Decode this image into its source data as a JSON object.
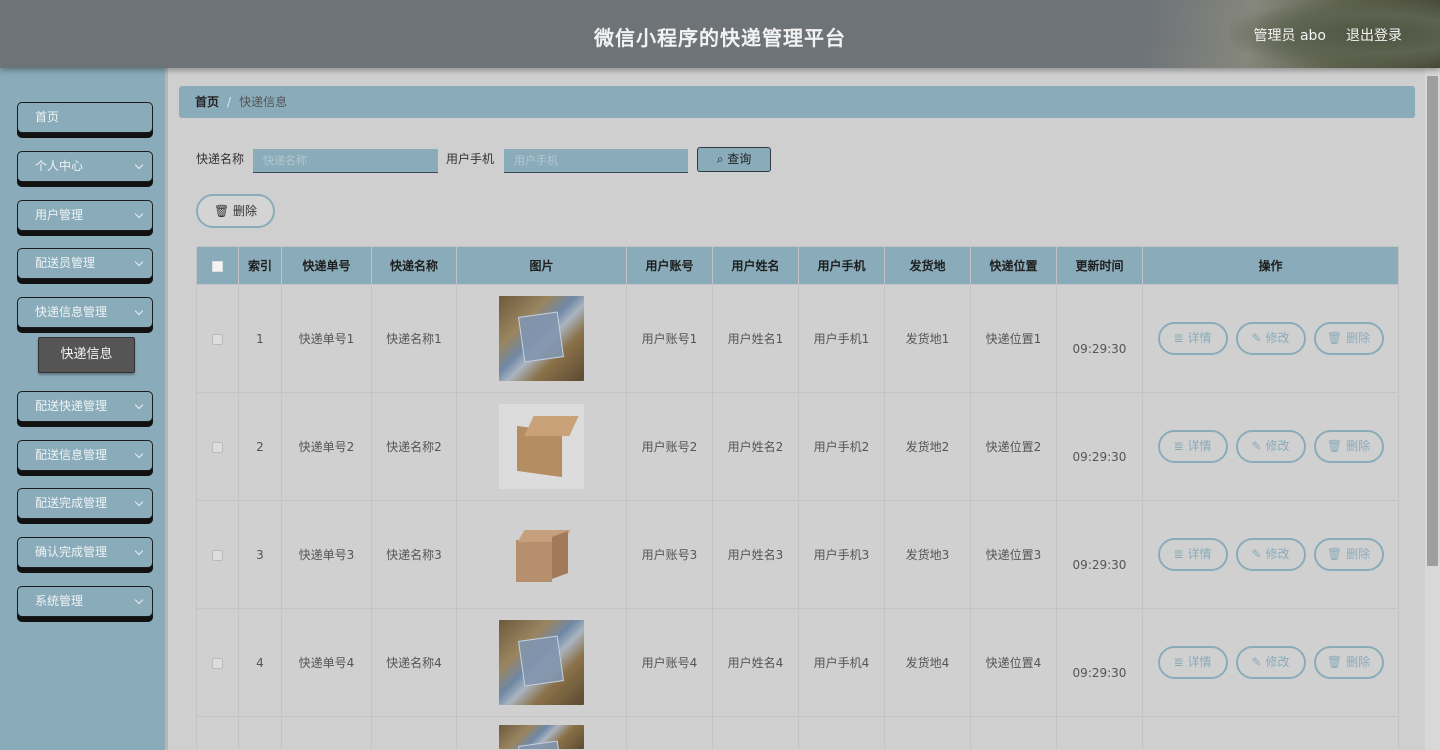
{
  "header": {
    "title": "微信小程序的快递管理平台",
    "user": "管理员 abo",
    "logout": "退出登录"
  },
  "sidebar": {
    "items": [
      {
        "label": "首页",
        "has_chevron": false
      },
      {
        "label": "个人中心",
        "has_chevron": true
      },
      {
        "label": "用户管理",
        "has_chevron": true
      },
      {
        "label": "配送员管理",
        "has_chevron": true
      },
      {
        "label": "快递信息管理",
        "has_chevron": true
      },
      {
        "label": "配送快递管理",
        "has_chevron": true
      },
      {
        "label": "配送信息管理",
        "has_chevron": true
      },
      {
        "label": "配送完成管理",
        "has_chevron": true
      },
      {
        "label": "确认完成管理",
        "has_chevron": true
      },
      {
        "label": "系统管理",
        "has_chevron": true
      }
    ],
    "active_sub": "快递信息"
  },
  "breadcrumb": {
    "home": "首页",
    "separator": "/",
    "current": "快递信息"
  },
  "search": {
    "name_label": "快递名称",
    "name_placeholder": "快递名称",
    "phone_label": "用户手机",
    "phone_placeholder": "用户手机",
    "query_label": "查询"
  },
  "actions": {
    "delete_label": "删除"
  },
  "table": {
    "headers": [
      "",
      "索引",
      "快递单号",
      "快递名称",
      "图片",
      "用户账号",
      "用户姓名",
      "用户手机",
      "发货地",
      "快递位置",
      "更新时间",
      "操作"
    ],
    "rows": [
      {
        "index": "1",
        "tracking": "快递单号1",
        "name": "快递名称1",
        "image": "parcels-photo",
        "account": "用户账号1",
        "username": "用户姓名1",
        "phone": "用户手机1",
        "origin": "发货地1",
        "location": "快递位置1",
        "time": "09:29:30"
      },
      {
        "index": "2",
        "tracking": "快递单号2",
        "name": "快递名称2",
        "image": "cardboard-box-photo",
        "account": "用户账号2",
        "username": "用户姓名2",
        "phone": "用户手机2",
        "origin": "发货地2",
        "location": "快递位置2",
        "time": "09:29:30"
      },
      {
        "index": "3",
        "tracking": "快递单号3",
        "name": "快递名称3",
        "image": "small-box-photo",
        "account": "用户账号3",
        "username": "用户姓名3",
        "phone": "用户手机3",
        "origin": "发货地3",
        "location": "快递位置3",
        "time": "09:29:30"
      },
      {
        "index": "4",
        "tracking": "快递单号4",
        "name": "快递名称4",
        "image": "parcels-photo",
        "account": "用户账号4",
        "username": "用户姓名4",
        "phone": "用户手机4",
        "origin": "发货地4",
        "location": "快递位置4",
        "time": "09:29:30"
      }
    ],
    "row_actions": {
      "detail": "详情",
      "edit": "修改",
      "delete": "删除"
    }
  },
  "colors": {
    "accent": "#8aacba",
    "header_bg": "#6e7378",
    "page_bg": "#cfcfcf",
    "submenu_active_bg": "#555555"
  }
}
